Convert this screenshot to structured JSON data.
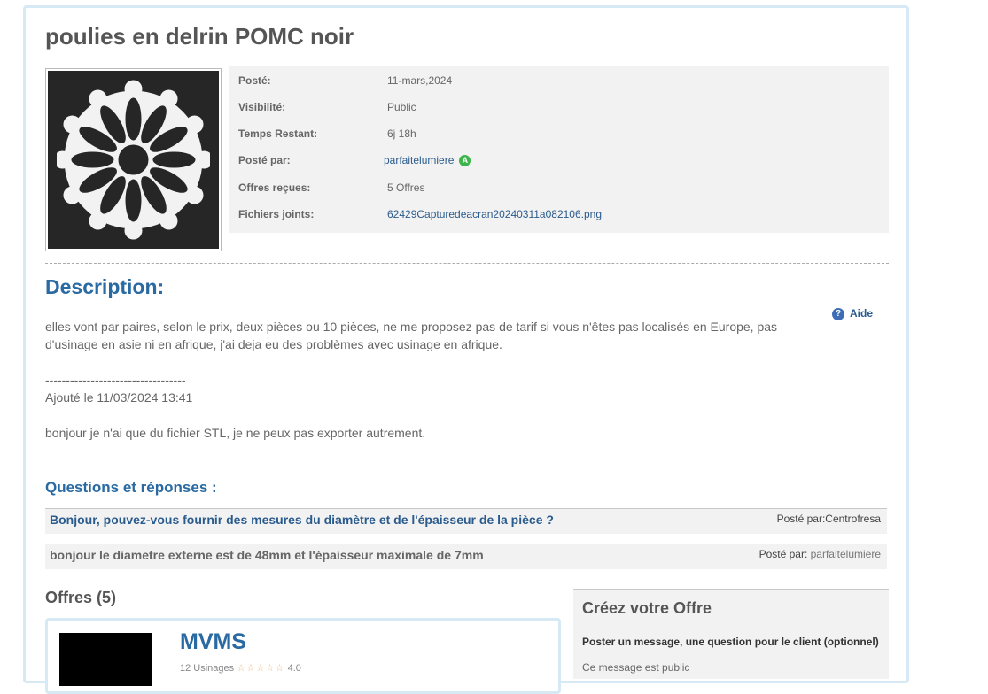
{
  "title": "poulies en delrin POMC noir",
  "meta": {
    "posted_label": "Posté:",
    "posted_value": "11-mars,2024",
    "visibility_label": "Visibilité:",
    "visibility_value": "Public",
    "time_left_label": "Temps Restant:",
    "time_left_value": "6j 18h",
    "posted_by_label": "Posté par:",
    "posted_by_value": "parfaitelumiere",
    "posted_by_badge": "A",
    "offers_label": "Offres reçues:",
    "offers_value": "5 Offres",
    "files_label": "Fichiers joints:",
    "files_value": "62429Capturedeacran20240311a082106.png"
  },
  "description": {
    "title": "Description:",
    "help_label": "Aide",
    "help_icon": "?",
    "paragraph1": "elles vont par paires, selon le prix, deux pièces ou 10 pièces, ne me proposez pas de tarif si vous n'êtes pas localisés en Europe, pas d'usinage en asie ni en afrique, j'ai deja eu des problèmes avec usinage en afrique.",
    "separator": "----------------------------------",
    "added": "Ajouté le 11/03/2024 13:41",
    "paragraph2": "bonjour je n'ai que du fichier STL, je ne peux pas exporter autrement."
  },
  "qa": {
    "title": "Questions et réponses :",
    "items": [
      {
        "text": "Bonjour, pouvez-vous fournir des mesures du diamètre et de l'épaisseur de la pièce ?",
        "by_label": "Posté par:",
        "by": "Centrofresa"
      },
      {
        "text": "bonjour le diametre externe est de 48mm et l'épaisseur maximale de 7mm",
        "by_label": "Posté par: ",
        "by": "parfaitelumiere"
      }
    ]
  },
  "offers": {
    "title": "Offres (5)",
    "first": {
      "name": "MVMS",
      "sub": "12 Usinages",
      "stars": "☆☆☆☆☆",
      "rating": "4.0"
    }
  },
  "create": {
    "title": "Créez votre Offre",
    "subtitle": "Poster un message, une question pour le client (optionnel)",
    "note": "Ce message est public"
  },
  "colors": {
    "accent": "#2a6aa3",
    "link": "#2a5b8d",
    "badge": "#3bb54a"
  }
}
